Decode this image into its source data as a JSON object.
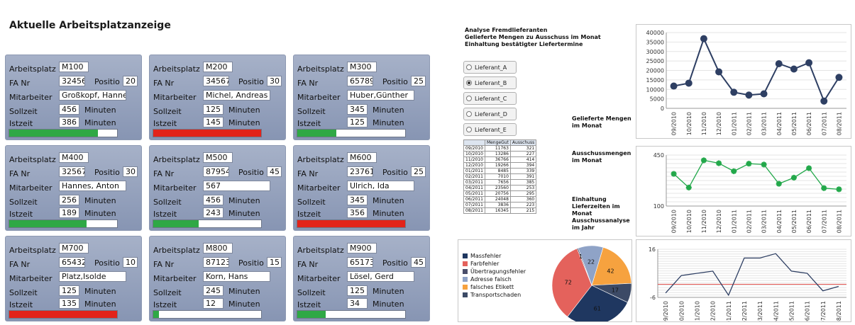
{
  "app_title": "Aktuelle Arbeitsplatzanzeige",
  "labels": {
    "arbeitsplatz": "Arbeitsplatz",
    "fa_nr": "FA Nr",
    "position": "Positio",
    "mitarbeiter": "Mitarbeiter",
    "sollzeit": "Sollzeit",
    "istzeit": "Istzeit",
    "minuten": "Minuten"
  },
  "workstations": [
    {
      "id": "M100",
      "fa": "32456",
      "pos": "20",
      "mitarbeiter": "Großkopf, Hanne:",
      "soll": "456",
      "ist": "386",
      "progress": 0.82,
      "bar_color": "#2fa845"
    },
    {
      "id": "M200",
      "fa": "34567",
      "pos": "30",
      "mitarbeiter": "Michel, Andreas",
      "soll": "125",
      "ist": "145",
      "progress": 1.0,
      "bar_color": "#e2231a"
    },
    {
      "id": "M300",
      "fa": "65789",
      "pos": "25",
      "mitarbeiter": "Huber,Günther",
      "soll": "345",
      "ist": "125",
      "progress": 0.36,
      "bar_color": "#2fa845"
    },
    {
      "id": "M400",
      "fa": "32567",
      "pos": "30",
      "mitarbeiter": "Hannes, Anton",
      "soll": "256",
      "ist": "189",
      "progress": 0.72,
      "bar_color": "#2fa845"
    },
    {
      "id": "M500",
      "fa": "87954",
      "pos": "45",
      "mitarbeiter": "567",
      "soll": "456",
      "ist": "243",
      "progress": 0.42,
      "bar_color": "#2fa845"
    },
    {
      "id": "M600",
      "fa": "23761",
      "pos": "25",
      "mitarbeiter": "Ulrich, Ida",
      "soll": "345",
      "ist": "356",
      "progress": 1.0,
      "bar_color": "#e2231a"
    },
    {
      "id": "M700",
      "fa": "65432",
      "pos": "10",
      "mitarbeiter": "Platz,Isolde",
      "soll": "125",
      "ist": "135",
      "progress": 1.0,
      "bar_color": "#e2231a"
    },
    {
      "id": "M800",
      "fa": "87123",
      "pos": "15",
      "mitarbeiter": "Korn, Hans",
      "soll": "245",
      "ist": "12",
      "progress": 0.05,
      "bar_color": "#2fa845"
    },
    {
      "id": "M900",
      "fa": "65173",
      "pos": "45",
      "mitarbeiter": "Lösel, Gerd",
      "soll": "125",
      "ist": "34",
      "progress": 0.26,
      "bar_color": "#2fa845"
    }
  ],
  "analysis": {
    "header": [
      "Analyse Fremdlieferanten",
      "Gelieferte Mengen zu Ausschuss im Monat",
      "Einhaltung bestätigter Liefertermine"
    ],
    "suppliers": [
      {
        "label": "Lieferant_A",
        "selected": false
      },
      {
        "label": "Lieferant_B",
        "selected": true
      },
      {
        "label": "Lieferant_C",
        "selected": false
      },
      {
        "label": "Lieferant_D",
        "selected": false
      },
      {
        "label": "Lieferant_E",
        "selected": false
      }
    ],
    "label_mengen": [
      "Gelieferte Mengen",
      "im Monat"
    ],
    "label_ausschuss": [
      "Ausschussmengen",
      "im Monat"
    ],
    "label_einhaltung": [
      "Einhaltung",
      "Lieferzeiten im",
      "Monat",
      "Ausschussanalyse",
      "im Jahr"
    ],
    "table": {
      "headers": [
        "",
        "MengeGut",
        "Ausschuss"
      ],
      "rows": [
        [
          "09/2010",
          "11763",
          "321"
        ],
        [
          "10/2010",
          "13286",
          "227"
        ],
        [
          "11/2010",
          "36766",
          "414"
        ],
        [
          "12/2010",
          "19266",
          "394"
        ],
        [
          "01/2011",
          "8485",
          "339"
        ],
        [
          "02/2011",
          "7010",
          "391"
        ],
        [
          "03/2011",
          "7656",
          "385"
        ],
        [
          "04/2011",
          "23560",
          "253"
        ],
        [
          "05/2011",
          "20756",
          "295"
        ],
        [
          "06/2011",
          "24048",
          "360"
        ],
        [
          "07/2011",
          "3836",
          "223"
        ],
        [
          "08/2011",
          "16345",
          "215"
        ]
      ]
    }
  },
  "colors": {
    "navy": "#2e3f63",
    "green": "#22a84a",
    "red_line": "#e3514e"
  },
  "chart_data": [
    {
      "type": "line",
      "categories": [
        "09/2010",
        "10/2010",
        "11/2010",
        "12/2010",
        "01/2011",
        "02/2011",
        "03/2011",
        "04/2011",
        "05/2011",
        "06/2011",
        "07/2011",
        "08/2011"
      ],
      "values": [
        11763,
        13286,
        36766,
        19266,
        8485,
        7010,
        7656,
        23560,
        20756,
        24048,
        3836,
        16345
      ],
      "yticks": [
        0,
        5000,
        10000,
        15000,
        20000,
        25000,
        30000,
        35000,
        40000
      ],
      "ylim": [
        0,
        40000
      ],
      "grid": true
    },
    {
      "type": "line",
      "categories": [
        "09/2010",
        "10/2010",
        "11/2010",
        "12/2010",
        "01/2011",
        "02/2011",
        "03/2011",
        "04/2011",
        "05/2011",
        "06/2011",
        "07/2011",
        "08/2011"
      ],
      "values": [
        321,
        227,
        414,
        394,
        339,
        391,
        385,
        253,
        295,
        360,
        223,
        215
      ],
      "yticks": [
        100,
        450
      ],
      "ylim": [
        100,
        450
      ],
      "grid": true
    },
    {
      "type": "pie",
      "slices": [
        {
          "label": "Massfehler",
          "value": 61,
          "color": "#1f3760"
        },
        {
          "label": "Farbfehler",
          "value": 72,
          "color": "#e4625c"
        },
        {
          "label": "Übertragungsfehler",
          "value": 1,
          "color": "#4a4e6a"
        },
        {
          "label": "Adresse falsch",
          "value": 22,
          "color": "#8fa3c7"
        },
        {
          "label": "falsches Etikett",
          "value": 42,
          "color": "#f6a23f"
        },
        {
          "label": "Transportschaden",
          "value": 17,
          "color": "#3c4a66"
        }
      ]
    },
    {
      "type": "line",
      "categories": [
        "09/2010",
        "10/2010",
        "11/2010",
        "12/2010",
        "01/2011",
        "02/2011",
        "03/2011",
        "04/2011",
        "05/2011",
        "06/2011",
        "07/2011",
        "08/2011"
      ],
      "values": [
        -4,
        4,
        5,
        6,
        -5,
        12,
        12,
        14,
        6,
        5,
        -3,
        -1
      ],
      "yticks": [
        -6,
        16
      ],
      "ylim": [
        -6,
        16
      ],
      "reference": 0,
      "grid": true
    }
  ]
}
